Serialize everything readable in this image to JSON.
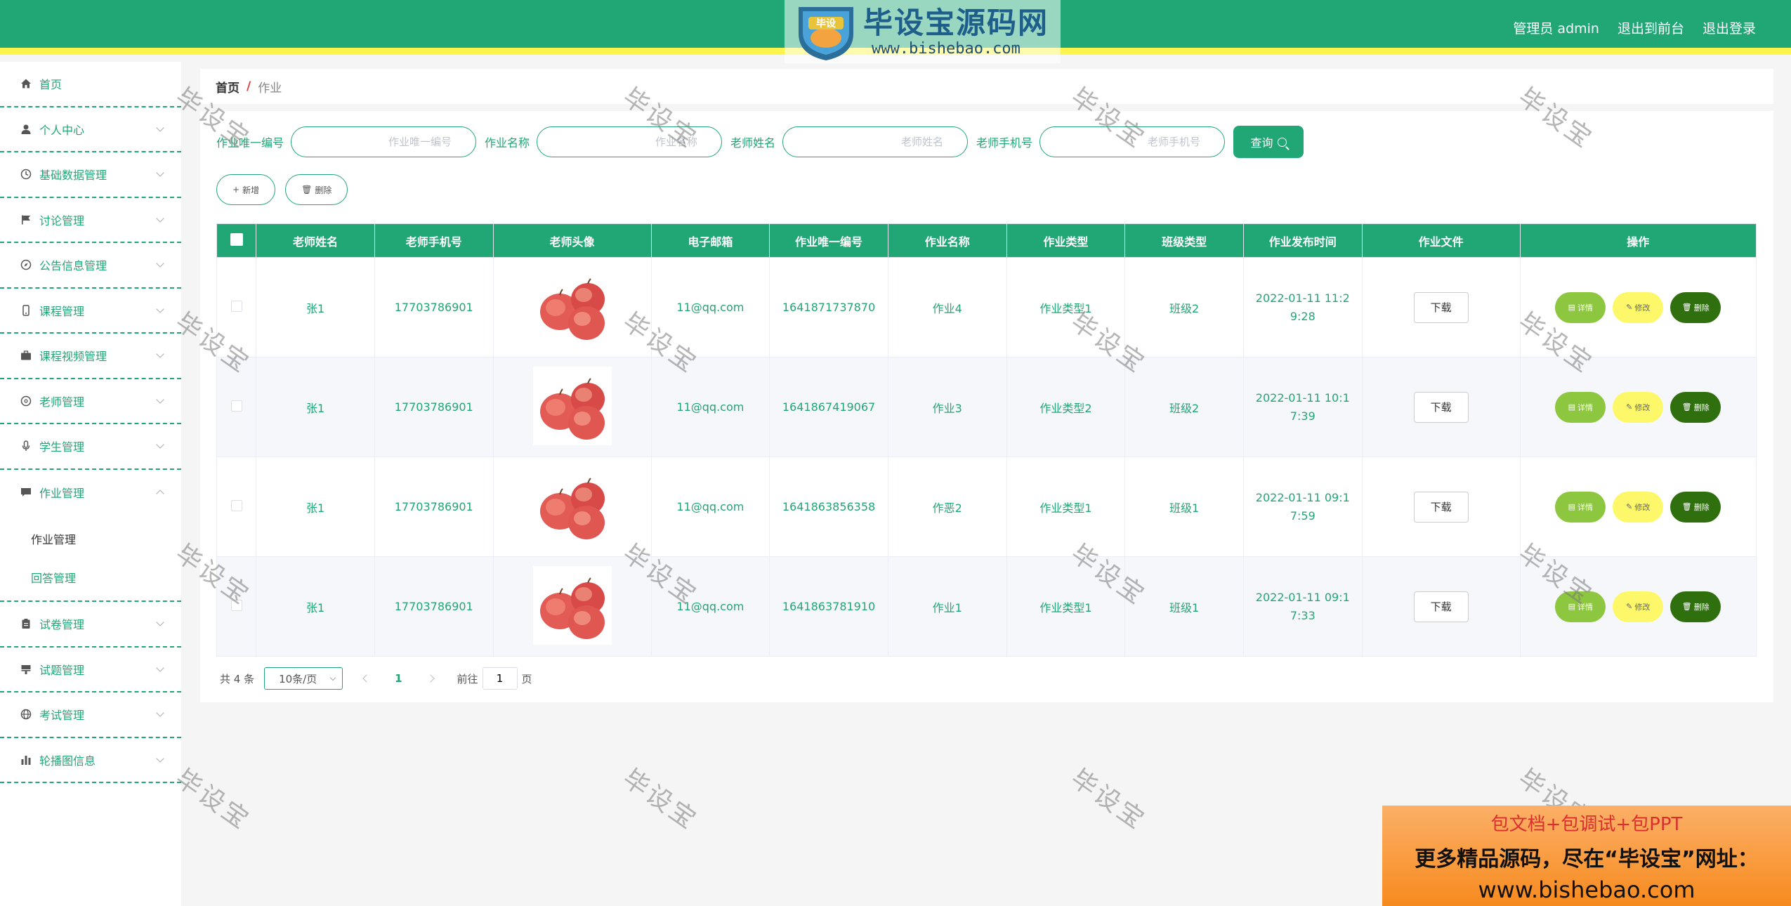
{
  "header": {
    "admin_label": "管理员 admin",
    "frontend_link": "退出到前台",
    "logout_link": "退出登录",
    "brand_name": "毕设宝源码网",
    "brand_url": "www.bishebao.com",
    "brand_badge": "毕设"
  },
  "sidebar": {
    "items": [
      {
        "label": "首页",
        "icon": "home-icon"
      },
      {
        "label": "个人中心",
        "icon": "user-icon"
      },
      {
        "label": "基础数据管理",
        "icon": "clock-icon"
      },
      {
        "label": "讨论管理",
        "icon": "flag-icon"
      },
      {
        "label": "公告信息管理",
        "icon": "compass-icon"
      },
      {
        "label": "课程管理",
        "icon": "phone-icon"
      },
      {
        "label": "课程视频管理",
        "icon": "suitcase-icon"
      },
      {
        "label": "老师管理",
        "icon": "globe-icon"
      },
      {
        "label": "学生管理",
        "icon": "mic-icon"
      },
      {
        "label": "作业管理",
        "icon": "chat-icon"
      },
      {
        "label": "试卷管理",
        "icon": "clipboard-icon"
      },
      {
        "label": "试题管理",
        "icon": "brush-icon"
      },
      {
        "label": "考试管理",
        "icon": "sphere-icon"
      },
      {
        "label": "轮播图信息",
        "icon": "bar-chart-icon"
      }
    ],
    "submenu": [
      "作业管理",
      "回答管理"
    ]
  },
  "breadcrumb": {
    "home": "首页",
    "separator": "/",
    "current": "作业"
  },
  "search": {
    "fields": [
      {
        "label": "作业唯一编号",
        "placeholder": "作业唯一编号"
      },
      {
        "label": "作业名称",
        "placeholder": "作业名称"
      },
      {
        "label": "老师姓名",
        "placeholder": "老师姓名"
      },
      {
        "label": "老师手机号",
        "placeholder": "老师手机号"
      }
    ],
    "button": "查询"
  },
  "actions": {
    "add": "新增",
    "delete": "删除"
  },
  "table": {
    "headers": [
      "老师姓名",
      "老师手机号",
      "老师头像",
      "电子邮箱",
      "作业唯一编号",
      "作业名称",
      "作业类型",
      "班级类型",
      "作业发布时间",
      "作业文件",
      "操作"
    ],
    "rows": [
      {
        "teacher": "张1",
        "phone": "17703786901",
        "email": "11@qq.com",
        "code": "1641871737870",
        "name": "作业4",
        "type": "作业类型1",
        "class": "班级2",
        "time": "2022-01-11 11:29:28",
        "file": "下载"
      },
      {
        "teacher": "张1",
        "phone": "17703786901",
        "email": "11@qq.com",
        "code": "1641867419067",
        "name": "作业3",
        "type": "作业类型2",
        "class": "班级2",
        "time": "2022-01-11 10:17:39",
        "file": "下载"
      },
      {
        "teacher": "张1",
        "phone": "17703786901",
        "email": "11@qq.com",
        "code": "1641863856358",
        "name": "作恶2",
        "type": "作业类型1",
        "class": "班级1",
        "time": "2022-01-11 09:17:59",
        "file": "下载"
      },
      {
        "teacher": "张1",
        "phone": "17703786901",
        "email": "11@qq.com",
        "code": "1641863781910",
        "name": "作业1",
        "type": "作业类型1",
        "class": "班级1",
        "time": "2022-01-11 09:17:33",
        "file": "下载"
      }
    ],
    "op_labels": {
      "detail": "详情",
      "edit": "修改",
      "delete": "删除"
    }
  },
  "pagination": {
    "total": "共 4 条",
    "page_size": "10条/页",
    "current_page": "1",
    "goto_label": "前往",
    "goto_value": "1",
    "goto_suffix": "页"
  },
  "watermark": "毕设宝",
  "ad": {
    "line1": "包文档+包调试+包PPT",
    "line2": "更多精品源码，尽在“毕设宝”网址：",
    "line3": "www.bishebao.com"
  },
  "colors": {
    "primary": "#21a675",
    "accent_yellow": "#fcf34c",
    "detail": "#8dc63f",
    "edit": "#fdf86a",
    "delete": "#2f6f0e"
  }
}
